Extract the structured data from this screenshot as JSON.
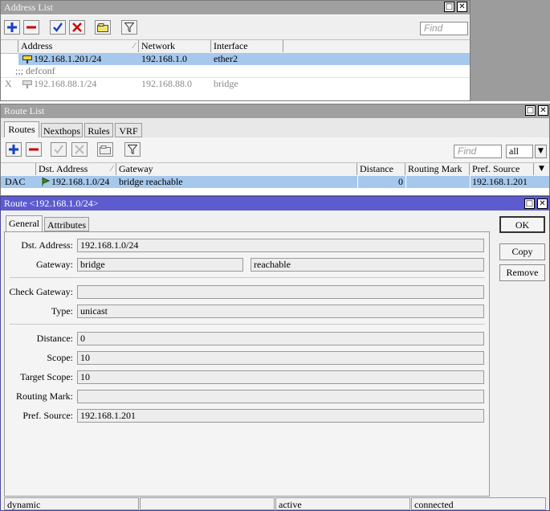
{
  "address_list": {
    "title": "Address List",
    "find_placeholder": "Find",
    "columns": [
      "Address",
      "Network",
      "Interface"
    ],
    "rows": [
      {
        "flag": "",
        "address": "192.168.1.201/24",
        "network": "192.168.1.0",
        "interface": "ether2",
        "selected": true
      },
      {
        "comment": ";;; defconf"
      },
      {
        "flag": "X",
        "address": "192.168.88.1/24",
        "network": "192.168.88.0",
        "interface": "bridge",
        "disabled": true
      }
    ]
  },
  "route_list": {
    "title": "Route List",
    "tabs": [
      "Routes",
      "Nexthops",
      "Rules",
      "VRF"
    ],
    "find_placeholder": "Find",
    "filter_value": "all",
    "columns": [
      "Dst. Address",
      "Gateway",
      "Distance",
      "Routing Mark",
      "Pref. Source"
    ],
    "rows": [
      {
        "flags": "DAC",
        "dst_address": "192.168.1.0/24",
        "gateway": "bridge reachable",
        "distance": "0",
        "routing_mark": "",
        "pref_source": "192.168.1.201"
      }
    ]
  },
  "route_dialog": {
    "title": "Route <192.168.1.0/24>",
    "tabs": [
      "General",
      "Attributes"
    ],
    "fields": {
      "dst_address": {
        "label": "Dst. Address:",
        "value": "192.168.1.0/24"
      },
      "gateway": {
        "label": "Gateway:",
        "value": "bridge",
        "state": "reachable"
      },
      "check_gateway": {
        "label": "Check Gateway:",
        "value": ""
      },
      "type": {
        "label": "Type:",
        "value": "unicast"
      },
      "distance": {
        "label": "Distance:",
        "value": "0"
      },
      "scope": {
        "label": "Scope:",
        "value": "10"
      },
      "target_scope": {
        "label": "Target Scope:",
        "value": "10"
      },
      "routing_mark": {
        "label": "Routing Mark:",
        "value": ""
      },
      "pref_source": {
        "label": "Pref. Source:",
        "value": "192.168.1.201"
      }
    },
    "buttons": {
      "ok": "OK",
      "copy": "Copy",
      "remove": "Remove"
    },
    "status": [
      "dynamic",
      "",
      "active",
      "connected"
    ]
  },
  "colors": {
    "title_inactive": "#a0a0a0",
    "title_active": "#5c5ccf",
    "selected_row": "#a6c8ec",
    "add_icon": "#1a3fc0",
    "remove_icon": "#cc0000"
  }
}
